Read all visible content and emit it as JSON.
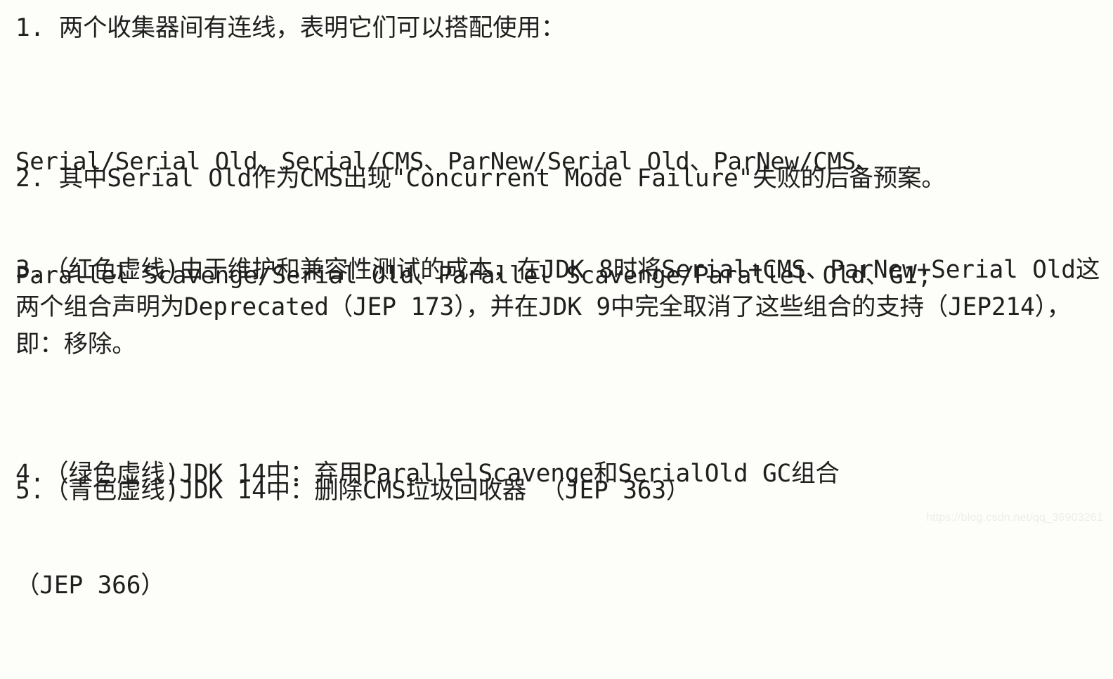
{
  "document": {
    "background_color": "#fdfdfa",
    "text_color": "#1f1f1f",
    "items": [
      {
        "id": "item-1",
        "text": "1. 两个收集器间有连线，表明它们可以搭配使用："
      },
      {
        "id": "item-1-combinations",
        "line_1": "Serial/Serial Old、Serial/CMS、ParNew/Serial Old、ParNew/CMS、",
        "line_2": "Parallel Scavenge/Serial Old、Parallel Scavenge/Parallel Old、G1;"
      },
      {
        "id": "item-2",
        "text": "2. 其中Serial Old作为CMS出现\"Concurrent Mode Failure\"失败的后备预案。"
      },
      {
        "id": "item-3",
        "text": "3.（红色虚线)由于维护和兼容性测试的成本，在JDK 8时将Serial+CMS、ParNew+Serial Old这两个组合声明为Deprecated（JEP 173），并在JDK 9中完全取消了这些组合的支持（JEP214），即：移除。"
      },
      {
        "id": "item-4",
        "line_1": "4.（绿色虚线)JDK 14中：弃用ParallelScavenge和SerialOld GC组合",
        "line_2": "（JEP 366）"
      },
      {
        "id": "item-5",
        "text": "5.（青色虚线)JDK 14中：删除CMS垃圾回收器 （JEP 363）"
      }
    ]
  },
  "watermark": {
    "text": "https://blog.csdn.net/qq_36903261",
    "color": "#eceeea"
  }
}
